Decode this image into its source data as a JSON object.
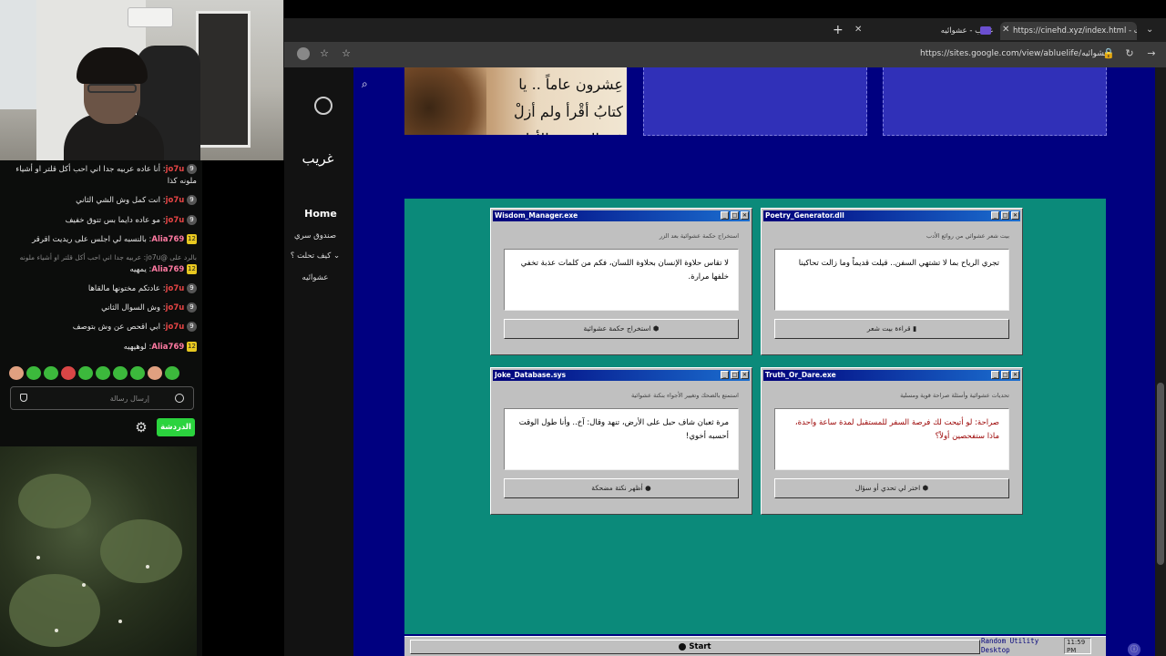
{
  "browser": {
    "tabs": [
      {
        "label": "غريب - عشوائيه"
      },
      {
        "label": "https://cinehd.xyz/index.html - ت"
      }
    ],
    "address": "https://sites.google.com/view/abluelife/عشوائيه"
  },
  "stream_chat": {
    "messages": [
      {
        "badge": "9",
        "user": "jo7u",
        "text": "أنا عاده عربيه جدا اني احب أكل قلتر او أشياء ملونه كذا"
      },
      {
        "badge": "9",
        "user": "jo7u",
        "text": "انت كمل وش الشي الثاني"
      },
      {
        "badge": "9",
        "user": "jo7u",
        "text": "مو عاده دايما بس تتوق خفيف"
      },
      {
        "badge": "12",
        "user": "Alia769",
        "text": "بالنسبه لي اجلس على ريديت اقرقر"
      },
      {
        "badge": "",
        "user": "jo7u",
        "text": "بالرد على @jo7u: عربيه جدا اني احب أكل قلتر او أشياء ملونه كذا"
      },
      {
        "badge": "12",
        "user": "Alia769",
        "text": "يمهيه"
      },
      {
        "badge": "9",
        "user": "jo7u",
        "text": "عادتكم مختونها مالقاها"
      },
      {
        "badge": "9",
        "user": "jo7u",
        "text": "وش السوال الثاني"
      },
      {
        "badge": "9",
        "user": "jo7u",
        "text": "ابي اقحص عن وش بتوصف"
      },
      {
        "badge": "12",
        "user": "Alia769",
        "text": "لوهيهيه"
      }
    ],
    "input_placeholder": "إرسال رسالة",
    "send_label": "الدردشة"
  },
  "site": {
    "title": "غريب",
    "nav": [
      "Home",
      "صندوق سري",
      "كيف تحلت ؟",
      "عشوائيه"
    ],
    "calligraphy": "عِشرون عاماً .. يا كتابُ أقْرأ\nولم أزلْ في الصفحةِ الأولى"
  },
  "windows": [
    {
      "title": "Wisdom_Manager.exe",
      "subtitle": "استخراج حكمة عشوائية بعد الزر",
      "output": "لا تقاس حلاوة الإنسان بحلاوة اللسان، فكم من كلمات عذبة تخفي خلفها مرارة.",
      "button": "استخراج حكمة عشوائية"
    },
    {
      "title": "Poetry_Generator.dll",
      "subtitle": "بيت شعر عشوائي من روائع الأدب",
      "output": "تجري الرياح بما لا تشتهي السفن.. قيلت قديماً وما زالت تحاكينا",
      "button": "قراءة بيت شعر"
    },
    {
      "title": "Joke_Database.sys",
      "subtitle": "استمتع بالضحك وتغيير الأجواء بنكتة عشوائية",
      "output": "مرة ثعبان شاف حبل على الأرض، تنهد وقال: آخ.. وأنا طول الوقت أحسبه أخوي!",
      "button": "أظهر نكتة مضحكة"
    },
    {
      "title": "Truth_Or_Dare.exe",
      "subtitle": "تحديات عشوائية وأسئلة صراحة قوية ومسلية",
      "output": "صراحة: لو أتيحت لك فرصة السفر للمستقبل لمدة ساعة واحدة، ماذا ستفحصين أولاً؟",
      "button": "اختر لي تحدي أو سؤال"
    }
  ],
  "taskbar": {
    "start": "Start",
    "label": "Random Utility Desktop",
    "clock_time": "11:59",
    "clock_ampm": "PM"
  }
}
